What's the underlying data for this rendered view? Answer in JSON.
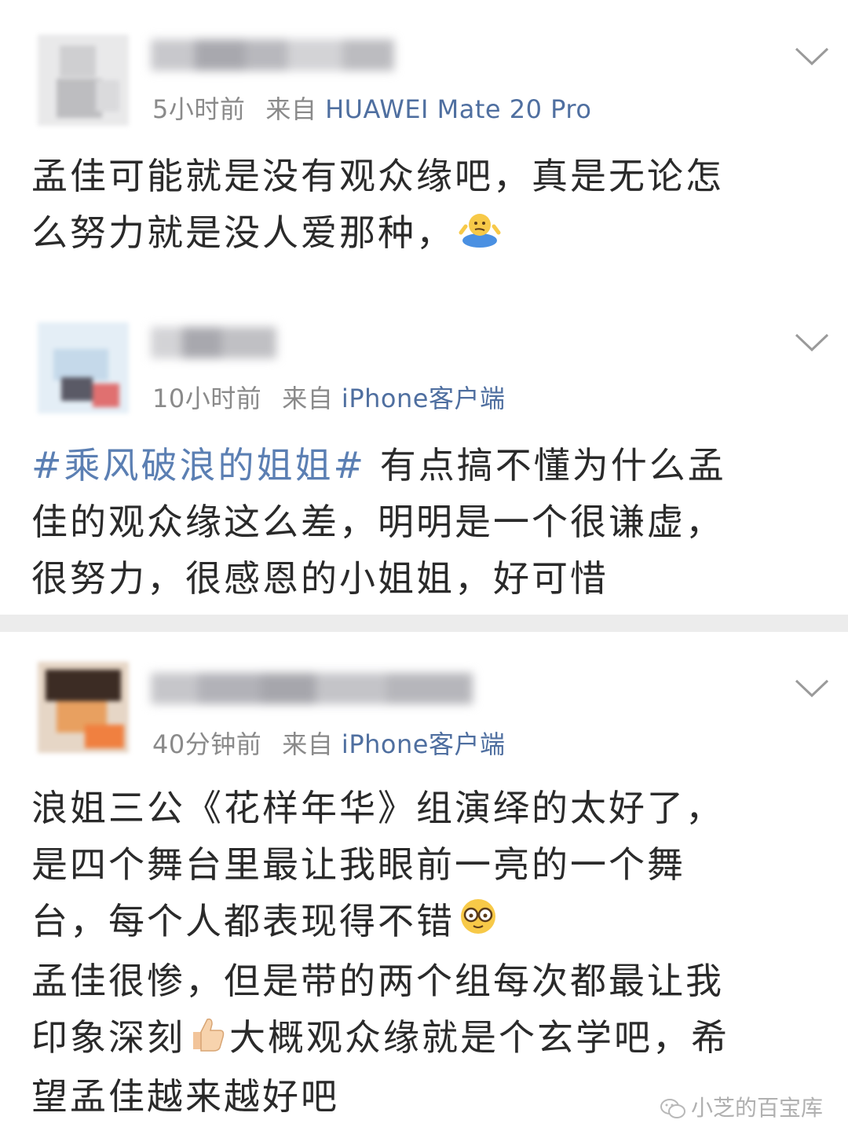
{
  "comments": [
    {
      "time": "5小时前",
      "from_label": "来自",
      "source": "HUAWEI Mate 20 Pro",
      "text_lines": [
        "孟佳可能就是没有观众缘吧，真是无论怎",
        "么努力就是没人爱那种，"
      ],
      "emoji": "shrug-emoji"
    },
    {
      "time": "10小时前",
      "from_label": "来自",
      "source": "iPhone客户端",
      "hashtag": "#乘风破浪的姐姐#",
      "text_lines": [
        " 有点搞不懂为什么孟",
        "佳的观众缘这么差，明明是一个很谦虚，",
        "很努力，很感恩的小姐姐，好可惜"
      ]
    },
    {
      "time": "40分钟前",
      "from_label": "来自",
      "source": "iPhone客户端",
      "text_lines": [
        "浪姐三公《花样年华》组演绎的太好了，",
        "是四个舞台里最让我眼前一亮的一个舞",
        "台，每个人都表现得不错",
        "孟佳很惨，但是带的两个组每次都最让我",
        "印象深刻",
        "大概观众缘就是个玄学吧，希",
        "望孟佳越来越好吧"
      ],
      "emojis": [
        "nerd-glasses-emoji",
        "thumbs-up-emoji"
      ]
    }
  ],
  "watermark": {
    "text": "小芝的百宝库",
    "icon": "wechat-icon"
  },
  "colors": {
    "source_blue": "#4f6fa0",
    "hashtag_blue": "#5b7fb3",
    "meta_gray": "#8a8a8a",
    "divider": "#ececec"
  }
}
